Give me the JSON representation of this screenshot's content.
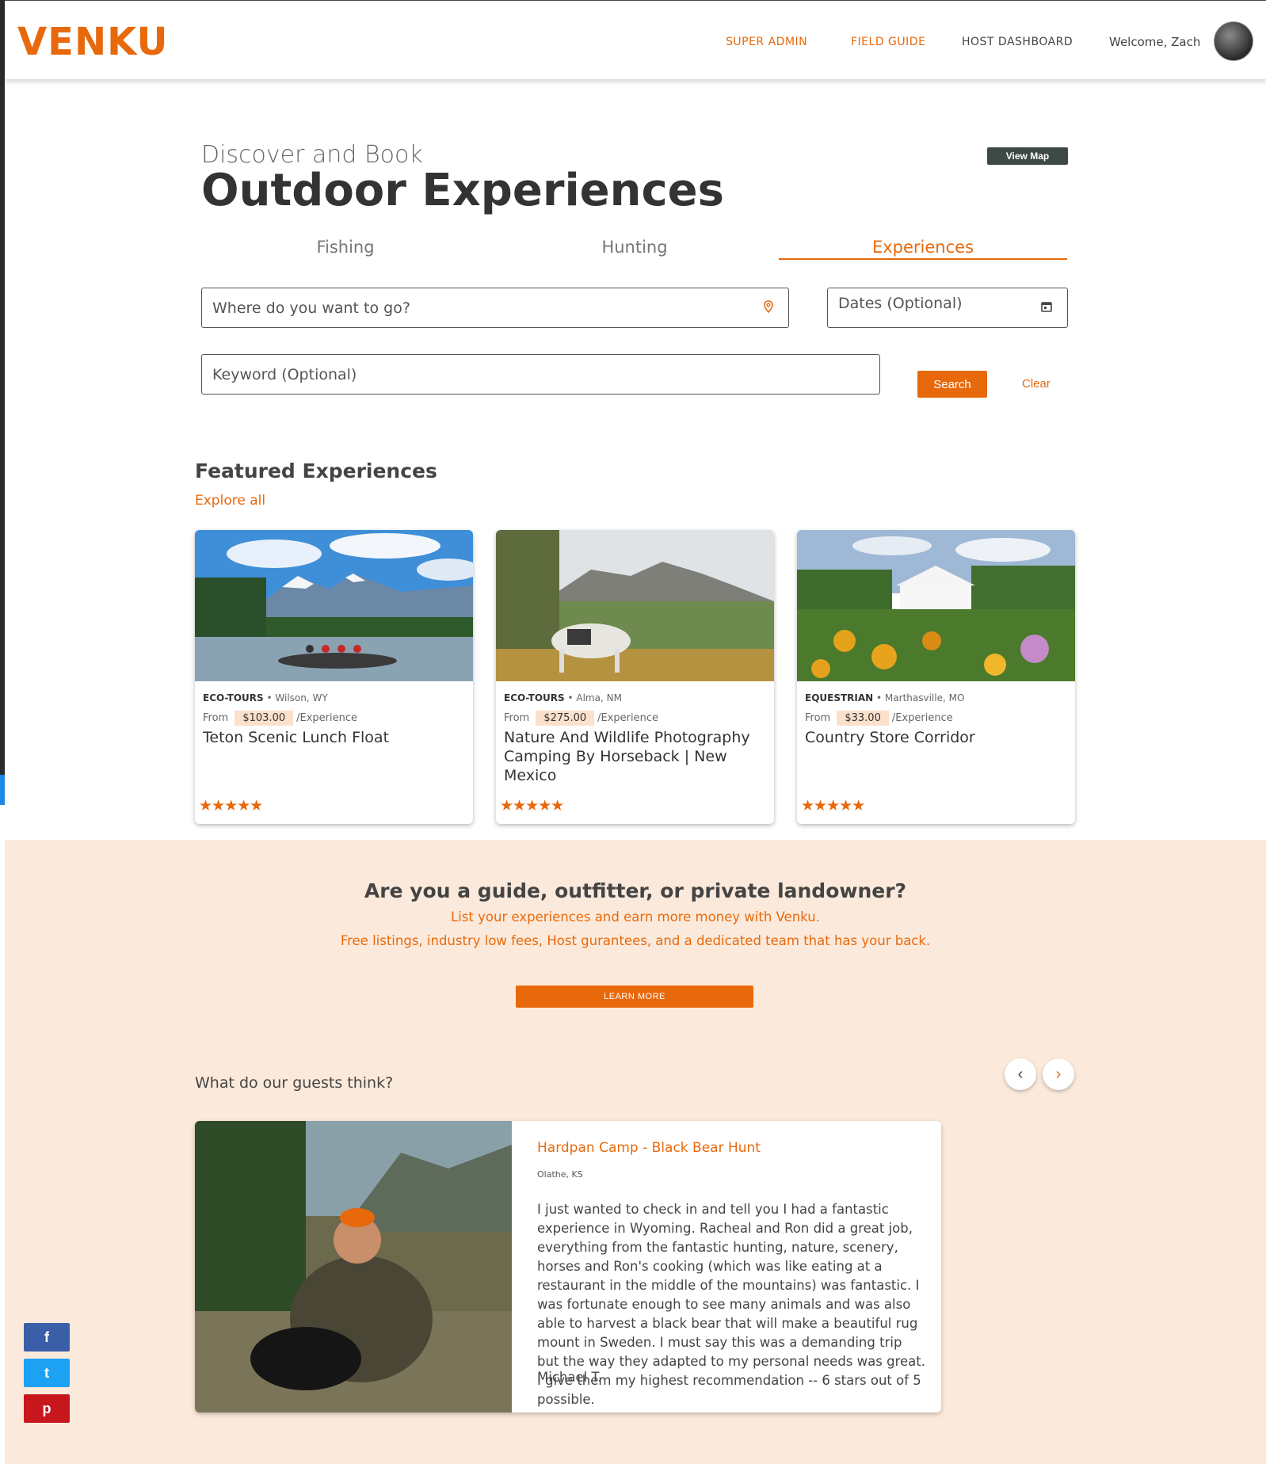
{
  "header": {
    "logo": "VENKU",
    "nav": [
      "SUPER ADMIN",
      "FIELD GUIDE",
      "HOST DASHBOARD"
    ],
    "welcome": "Welcome, Zach"
  },
  "hero": {
    "eyebrow": "Discover and Book",
    "title": "Outdoor Experiences",
    "view_map": "View Map"
  },
  "tabs": [
    "Fishing",
    "Hunting",
    "Experiences"
  ],
  "search": {
    "location_placeholder": "Where do you want to go?",
    "dates_placeholder": "Dates (Optional)",
    "keyword_placeholder": "Keyword (Optional)",
    "search_label": "Search",
    "clear_label": "Clear"
  },
  "featured": {
    "title": "Featured Experiences",
    "explore": "Explore all",
    "cards": [
      {
        "category": "ECO-TOURS",
        "location": "Wilson, WY",
        "from": "From",
        "price": "$103.00",
        "unit": "/Experience",
        "name": "Teton Scenic Lunch Float",
        "stars": "★★★★★"
      },
      {
        "category": "ECO-TOURS",
        "location": "Alma, NM",
        "from": "From",
        "price": "$275.00",
        "unit": "/Experience",
        "name": "Nature And Wildlife Photography Camping By Horseback | New Mexico",
        "stars": "★★★★★"
      },
      {
        "category": "EQUESTRIAN",
        "location": "Marthasville, MO",
        "from": "From",
        "price": "$33.00",
        "unit": "/Experience",
        "name": "Country Store Corridor",
        "stars": "★★★★★"
      }
    ]
  },
  "promo": {
    "heading": "Are you a guide, outfitter, or private landowner?",
    "line1": "List your experiences and earn more money with Venku.",
    "line2": "Free listings, industry low fees, Host gurantees, and a dedicated team that has your back.",
    "learn_more": "LEARN MORE"
  },
  "reviews": {
    "heading": "What do our guests think?",
    "prev": "‹",
    "next": "›",
    "item": {
      "title": "Hardpan Camp - Black Bear Hunt",
      "location": "Olathe, KS",
      "body": "I just wanted to check in and tell you I had a fantastic experience in Wyoming. Racheal and Ron did a great job, everything from the fantastic hunting, nature, scenery, horses and Ron's cooking (which was like eating at a restaurant in the middle of the mountains) was fantastic. I was fortunate enough to see many animals and was also able to harvest a black bear that will make a beautiful rug mount in Sweden. I must say this was a demanding trip but the way they adapted to my personal needs was great. I give them my highest recommendation -- 6 stars out of 5 possible.",
      "author": "Michael T."
    }
  },
  "social": {
    "facebook": "f",
    "twitter": "t",
    "pinterest": "p"
  },
  "colors": {
    "accent": "#e8690c",
    "promo_bg": "#fbeadb",
    "map_button": "#3d4a43"
  }
}
